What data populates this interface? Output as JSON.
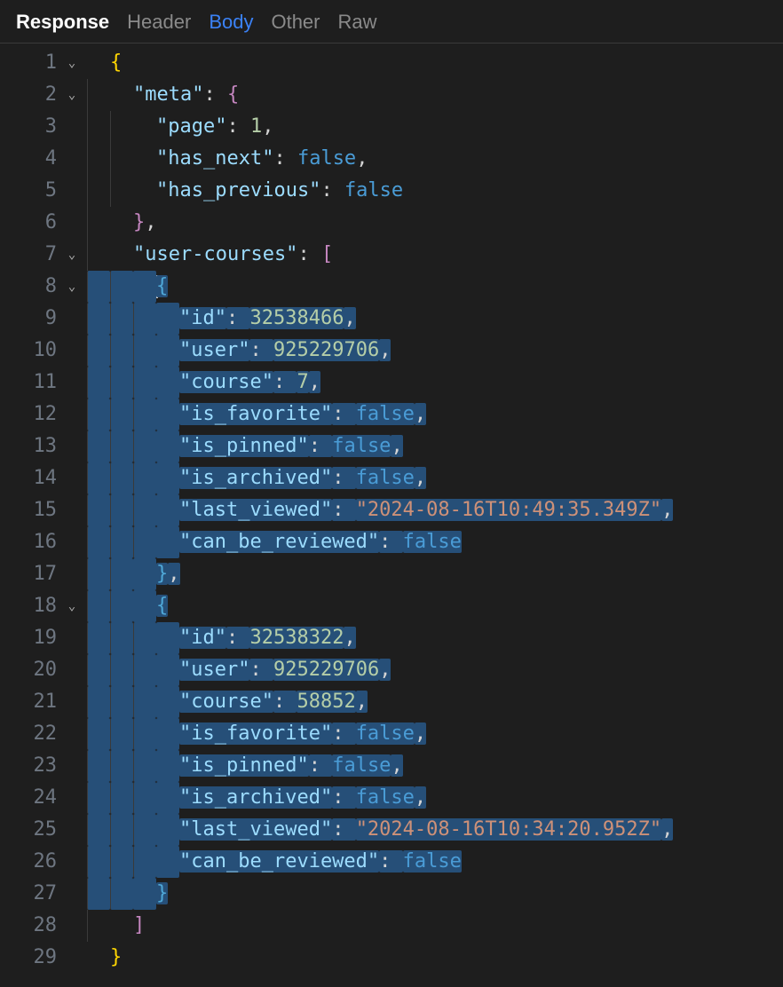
{
  "tabs": {
    "title": "Response",
    "items": [
      "Header",
      "Body",
      "Other",
      "Raw"
    ],
    "active": "Body"
  },
  "editor": {
    "line_numbers": [
      1,
      2,
      3,
      4,
      5,
      6,
      7,
      8,
      9,
      10,
      11,
      12,
      13,
      14,
      15,
      16,
      17,
      18,
      19,
      20,
      21,
      22,
      23,
      24,
      25,
      26,
      27,
      28,
      29
    ],
    "fold_lines": [
      1,
      2,
      7,
      8,
      18
    ],
    "json": {
      "meta": {
        "page": 1,
        "has_next": false,
        "has_previous": false
      },
      "user-courses": [
        {
          "id": 32538466,
          "user": 925229706,
          "course": 7,
          "is_favorite": false,
          "is_pinned": false,
          "is_archived": false,
          "last_viewed": "2024-08-16T10:49:35.349Z",
          "can_be_reviewed": false
        },
        {
          "id": 32538322,
          "user": 925229706,
          "course": 58852,
          "is_favorite": false,
          "is_pinned": false,
          "is_archived": false,
          "last_viewed": "2024-08-16T10:34:20.952Z",
          "can_be_reviewed": false
        }
      ]
    },
    "tokens": {
      "meta_key": "\"meta\"",
      "page_key": "\"page\"",
      "page_val": "1",
      "has_next_key": "\"has_next\"",
      "has_previous_key": "\"has_previous\"",
      "false_val": "false",
      "user_courses_key": "\"user-courses\"",
      "id_key": "\"id\"",
      "user_key": "\"user\"",
      "course_key": "\"course\"",
      "is_favorite_key": "\"is_favorite\"",
      "is_pinned_key": "\"is_pinned\"",
      "is_archived_key": "\"is_archived\"",
      "last_viewed_key": "\"last_viewed\"",
      "can_be_reviewed_key": "\"can_be_reviewed\"",
      "id1": "32538466",
      "user1": "925229706",
      "course1": "7",
      "lv1": "\"2024-08-16T10:49:35.349Z\"",
      "id2": "32538322",
      "user2": "925229706",
      "course2": "58852",
      "lv2": "\"2024-08-16T10:34:20.952Z\""
    }
  }
}
